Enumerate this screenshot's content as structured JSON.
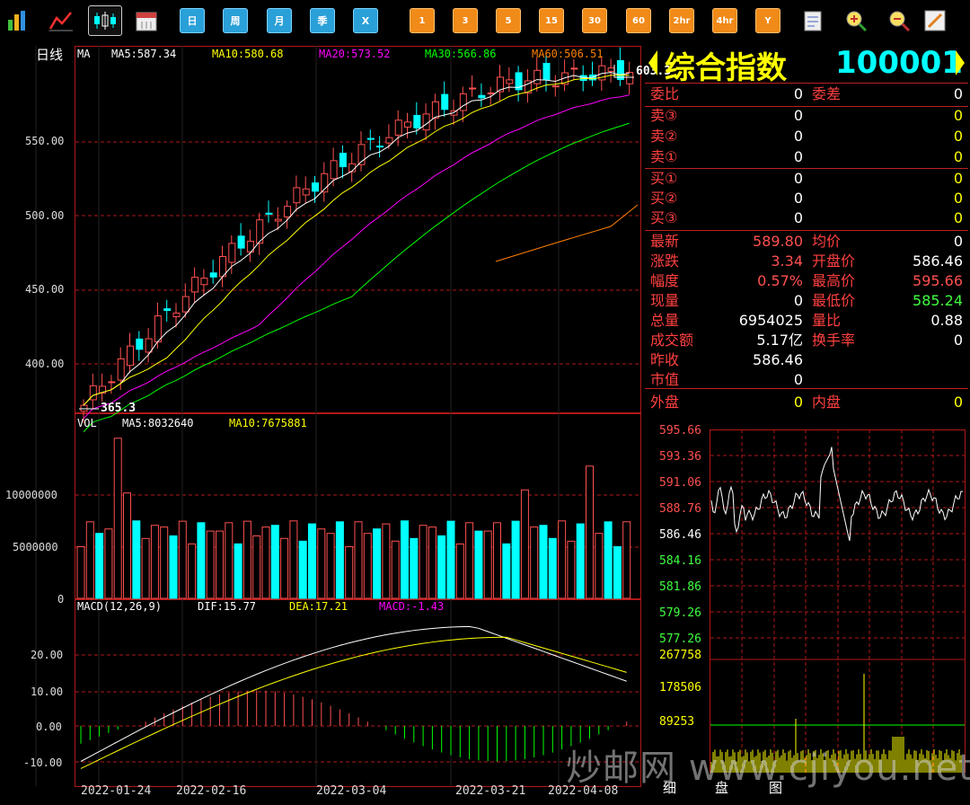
{
  "toolbar": {
    "periods": [
      "日",
      "周",
      "月",
      "季",
      "X"
    ],
    "minutes": [
      "1",
      "3",
      "5",
      "15",
      "30",
      "60",
      "2hr",
      "4hr",
      "Y"
    ]
  },
  "main_chart": {
    "period_label": "日线",
    "indicator": "MA",
    "ma5": "MA5:587.34",
    "ma10": "MA10:580.68",
    "ma20": "MA20:573.52",
    "ma30": "MA30:566.86",
    "ma60": "MA60:506.51",
    "high_marker": "603.3",
    "low_marker": "365.3",
    "y_ticks": [
      "550.00",
      "500.00",
      "450.00",
      "400.00"
    ],
    "colors": {
      "ma5": "#ffffff",
      "ma10": "#ffff00",
      "ma20": "#ff00ff",
      "ma30": "#00ff00",
      "ma60": "#ff8000",
      "up": "#ff5050",
      "down": "#00ffff"
    }
  },
  "volume_chart": {
    "label": "VOL",
    "ma5": "MA5:8032640",
    "ma10": "MA10:7675881",
    "y_ticks": [
      "10000000",
      "5000000",
      "0"
    ]
  },
  "macd_chart": {
    "label": "MACD(12,26,9)",
    "dif": "DIF:15.77",
    "dea": "DEA:17.21",
    "macd": "MACD:-1.43",
    "y_ticks": [
      "20.00",
      "10.00",
      "0.00",
      "-10.00"
    ]
  },
  "x_axis_dates": [
    "2022-01-24",
    "2022-02-16",
    "2022-03-04",
    "2022-03-21",
    "2022-04-08"
  ],
  "quote": {
    "title": "综合指数",
    "code": "100001",
    "weibi_label": "委比",
    "weibi": "0",
    "weicha_label": "委差",
    "weicha": "0",
    "asks": [
      {
        "label": "卖③",
        "price": "0",
        "vol": "0"
      },
      {
        "label": "卖②",
        "price": "0",
        "vol": "0"
      },
      {
        "label": "卖①",
        "price": "0",
        "vol": "0"
      }
    ],
    "bids": [
      {
        "label": "买①",
        "price": "0",
        "vol": "0"
      },
      {
        "label": "买②",
        "price": "0",
        "vol": "0"
      },
      {
        "label": "买③",
        "price": "0",
        "vol": "0"
      }
    ],
    "stats": [
      {
        "l1": "最新",
        "v1": "589.80",
        "c1": "#ff5050",
        "l2": "均价",
        "v2": "0",
        "c2": "#ffffff"
      },
      {
        "l1": "涨跌",
        "v1": "3.34",
        "c1": "#ff5050",
        "l2": "开盘价",
        "v2": "586.46",
        "c2": "#ffffff"
      },
      {
        "l1": "幅度",
        "v1": "0.57%",
        "c1": "#ff5050",
        "l2": "最高价",
        "v2": "595.66",
        "c2": "#ff5050"
      },
      {
        "l1": "现量",
        "v1": "0",
        "c1": "#ffffff",
        "l2": "最低价",
        "v2": "585.24",
        "c2": "#40ff40"
      },
      {
        "l1": "总量",
        "v1": "6954025",
        "c1": "#ffffff",
        "l2": "量比",
        "v2": "0.88",
        "c2": "#ffffff"
      },
      {
        "l1": "成交额",
        "v1": "5.17亿",
        "c1": "#ffffff",
        "l2": "换手率",
        "v2": "0",
        "c2": "#ffffff"
      },
      {
        "l1": "昨收",
        "v1": "586.46",
        "c1": "#ffffff",
        "l2": "",
        "v2": "",
        "c2": "#ffffff"
      },
      {
        "l1": "市值",
        "v1": "0",
        "c1": "#ffffff",
        "l2": "",
        "v2": "",
        "c2": "#ffffff"
      }
    ],
    "waipan_label": "外盘",
    "waipan": "0",
    "neipan_label": "内盘",
    "neipan": "0"
  },
  "intraday": {
    "price_ticks": [
      "595.66",
      "593.36",
      "591.06",
      "588.76",
      "586.46",
      "584.16",
      "581.86",
      "579.26",
      "577.26"
    ],
    "vol_ticks": [
      "267758",
      "178506",
      "89253"
    ],
    "bottom_tabs": [
      "细",
      "盘",
      "图"
    ]
  },
  "watermark": "炒邮网 www.cjiyou.net"
}
